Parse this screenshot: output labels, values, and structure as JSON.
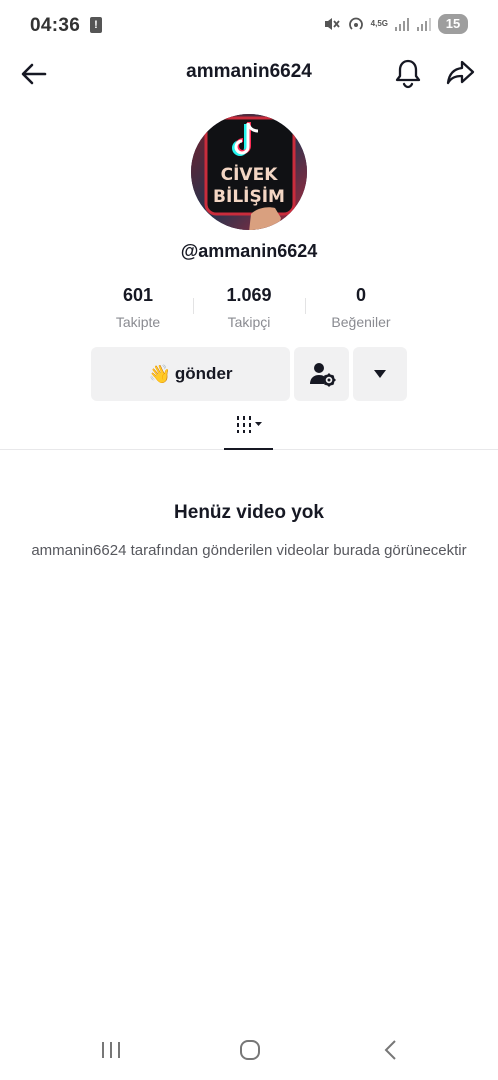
{
  "status_bar": {
    "time": "04:36",
    "network": "4,5G",
    "battery": "15"
  },
  "header": {
    "title": "ammanin6624"
  },
  "profile": {
    "avatar_text_line1": "CİVEK",
    "avatar_text_line2": "BİLİŞİM",
    "handle": "@ammanin6624"
  },
  "stats": [
    {
      "value": "601",
      "label": "Takipte"
    },
    {
      "value": "1.069",
      "label": "Takipçi"
    },
    {
      "value": "0",
      "label": "Beğeniler"
    }
  ],
  "actions": {
    "send_emoji": "👋",
    "send_label": "gönder"
  },
  "empty_state": {
    "title": "Henüz video yok",
    "description": "ammanin6624 tarafından gönderilen videolar burada görünecektir"
  },
  "colors": {
    "text_primary": "#161823",
    "text_secondary": "#8a8b91",
    "button_bg": "#f1f1f2"
  }
}
